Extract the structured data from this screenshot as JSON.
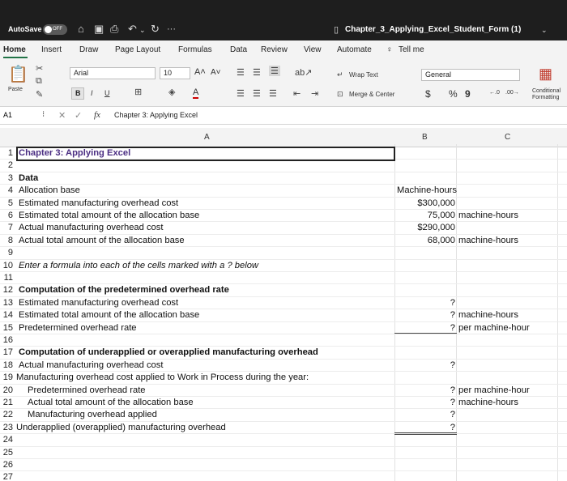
{
  "titlebar": {
    "autosave_label": "AutoSave",
    "autosave_state": "OFF",
    "more": "···",
    "document_title": "Chapter_3_Applying_Excel_Student_Form (1)"
  },
  "tabs": [
    "Home",
    "Insert",
    "Draw",
    "Page Layout",
    "Formulas",
    "Data",
    "Review",
    "View",
    "Automate"
  ],
  "tell_me": "Tell me",
  "ribbon": {
    "paste_label": "Paste",
    "font_name": "Arial",
    "font_size": "10",
    "bold": "B",
    "italic": "I",
    "underline": "U",
    "wrap_text": "Wrap Text",
    "merge_center": "Merge & Center",
    "number_format": "General",
    "currency": "$",
    "percent": "%",
    "comma": "9",
    "conditional_formatting": "Conditional Formatting"
  },
  "formula_bar": {
    "cell_ref": "A1",
    "fx": "fx",
    "content": "Chapter 3: Applying Excel"
  },
  "columns": [
    "A",
    "B",
    "C"
  ],
  "rows": [
    {
      "n": "1",
      "a": "Chapter 3: Applying Excel",
      "b": "",
      "c": ""
    },
    {
      "n": "2",
      "a": "",
      "b": "",
      "c": ""
    },
    {
      "n": "3",
      "a": "Data",
      "b": "",
      "c": ""
    },
    {
      "n": "4",
      "a": "Allocation base",
      "b": "Machine-hours",
      "c": ""
    },
    {
      "n": "5",
      "a": "Estimated manufacturing overhead cost",
      "b": "$300,000",
      "c": ""
    },
    {
      "n": "6",
      "a": "Estimated total amount of the allocation base",
      "b": "75,000",
      "c": "machine-hours"
    },
    {
      "n": "7",
      "a": "Actual manufacturing overhead cost",
      "b": "$290,000",
      "c": ""
    },
    {
      "n": "8",
      "a": "Actual total amount of the allocation base",
      "b": "68,000",
      "c": "machine-hours"
    },
    {
      "n": "9",
      "a": "",
      "b": "",
      "c": ""
    },
    {
      "n": "10",
      "a": "Enter a formula into each of the cells marked with a ? below",
      "b": "",
      "c": ""
    },
    {
      "n": "11",
      "a": "",
      "b": "",
      "c": ""
    },
    {
      "n": "12",
      "a": "Computation of the predetermined overhead rate",
      "b": "",
      "c": ""
    },
    {
      "n": "13",
      "a": "Estimated manufacturing overhead cost",
      "b": "?",
      "c": ""
    },
    {
      "n": "14",
      "a": "Estimated total amount of the allocation base",
      "b": "?",
      "c": "machine-hours"
    },
    {
      "n": "15",
      "a": "Predetermined overhead rate",
      "b": "?",
      "c": "per machine-hour"
    },
    {
      "n": "16",
      "a": "",
      "b": "",
      "c": ""
    },
    {
      "n": "17",
      "a": "Computation of underapplied or overapplied manufacturing overhead",
      "b": "",
      "c": ""
    },
    {
      "n": "18",
      "a": "Actual manufacturing overhead cost",
      "b": "?",
      "c": ""
    },
    {
      "n": "19",
      "a": "Manufacturing overhead cost applied to Work in Process during the year:",
      "b": "",
      "c": ""
    },
    {
      "n": "20",
      "a": "Predetermined overhead rate",
      "b": "?",
      "c": "per machine-hour"
    },
    {
      "n": "21",
      "a": "Actual total amount of the allocation base",
      "b": "?",
      "c": "machine-hours"
    },
    {
      "n": "22",
      "a": "Manufacturing overhead applied",
      "b": "?",
      "c": ""
    },
    {
      "n": "23",
      "a": "Underapplied (overapplied) manufacturing overhead",
      "b": "?",
      "c": ""
    },
    {
      "n": "24",
      "a": "",
      "b": "",
      "c": ""
    },
    {
      "n": "25",
      "a": "",
      "b": "",
      "c": ""
    },
    {
      "n": "26",
      "a": "",
      "b": "",
      "c": ""
    },
    {
      "n": "27",
      "a": "",
      "b": "",
      "c": ""
    }
  ],
  "colors": {
    "accent": "#217346",
    "header_text": "#4b2e83"
  }
}
